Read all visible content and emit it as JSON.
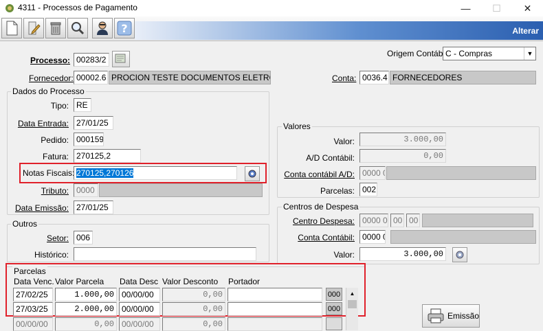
{
  "window": {
    "title": "4311 - Processos de Pagamento",
    "minimize": "—",
    "maximize": "☐",
    "close": "✕"
  },
  "toolbar": {
    "mode": "Alterar"
  },
  "header": {
    "processo_label": "Processo:",
    "processo_value": "00283/2",
    "fornecedor_label": "Fornecedor:",
    "fornecedor_code": "00002.6",
    "fornecedor_name": "PROCION TESTE DOCUMENTOS ELETRON L",
    "origem_label": "Origem Contábil:",
    "origem_value": "C - Compras",
    "conta_label": "Conta:",
    "conta_code": "0036.4",
    "conta_name": "FORNECEDORES"
  },
  "dados": {
    "title": "Dados do Processo",
    "tipo_label": "Tipo:",
    "tipo_value": "RE",
    "data_entrada_label": "Data Entrada:",
    "data_entrada_value": "27/01/25",
    "pedido_label": "Pedido:",
    "pedido_value": "000159",
    "fatura_label": "Fatura:",
    "fatura_value": "270125,2",
    "notas_label": "Notas Fiscais:",
    "notas_value": "270125,270126",
    "tributo_label": "Tributo:",
    "tributo_value": "0000",
    "data_emissao_label": "Data Emissão:",
    "data_emissao_value": "27/01/25"
  },
  "valores": {
    "title": "Valores",
    "valor_label": "Valor:",
    "valor_value": "3.000,00",
    "ad_label": "A/D Contábil:",
    "ad_value": "0,00",
    "conta_ad_label": "Conta contábil A/D:",
    "conta_ad_value": "0000 0",
    "parcelas_label": "Parcelas:",
    "parcelas_value": "002"
  },
  "centros": {
    "title": "Centros de Despesa",
    "centro_label": "Centro Despesa:",
    "centro_value": "0000 0",
    "centro_sub1": "00",
    "centro_sub2": "00",
    "conta_label": "Conta Contábil:",
    "conta_value": "0000 0",
    "valor_label": "Valor:",
    "valor_value": "3.000,00"
  },
  "outros": {
    "title": "Outros",
    "setor_label": "Setor:",
    "setor_value": "006",
    "historico_label": "Histórico:",
    "historico_value": ""
  },
  "parcelas": {
    "title": "Parcelas",
    "headers": [
      "Data Venc.",
      "Valor Parcela",
      "Data Desc",
      "Valor Desconto",
      "Portador"
    ],
    "rows": [
      {
        "venc": "27/02/25",
        "valor": "1.000,00",
        "desc": "00/00/00",
        "vdesc": "0,00",
        "portador": "",
        "code": "000"
      },
      {
        "venc": "27/03/25",
        "valor": "2.000,00",
        "desc": "00/00/00",
        "vdesc": "0,00",
        "portador": "",
        "code": "000"
      },
      {
        "venc": "00/00/00",
        "valor": "0,00",
        "desc": "00/00/00",
        "vdesc": "0,00",
        "portador": "",
        "code": ""
      }
    ]
  },
  "emissao_label": "Emissão"
}
